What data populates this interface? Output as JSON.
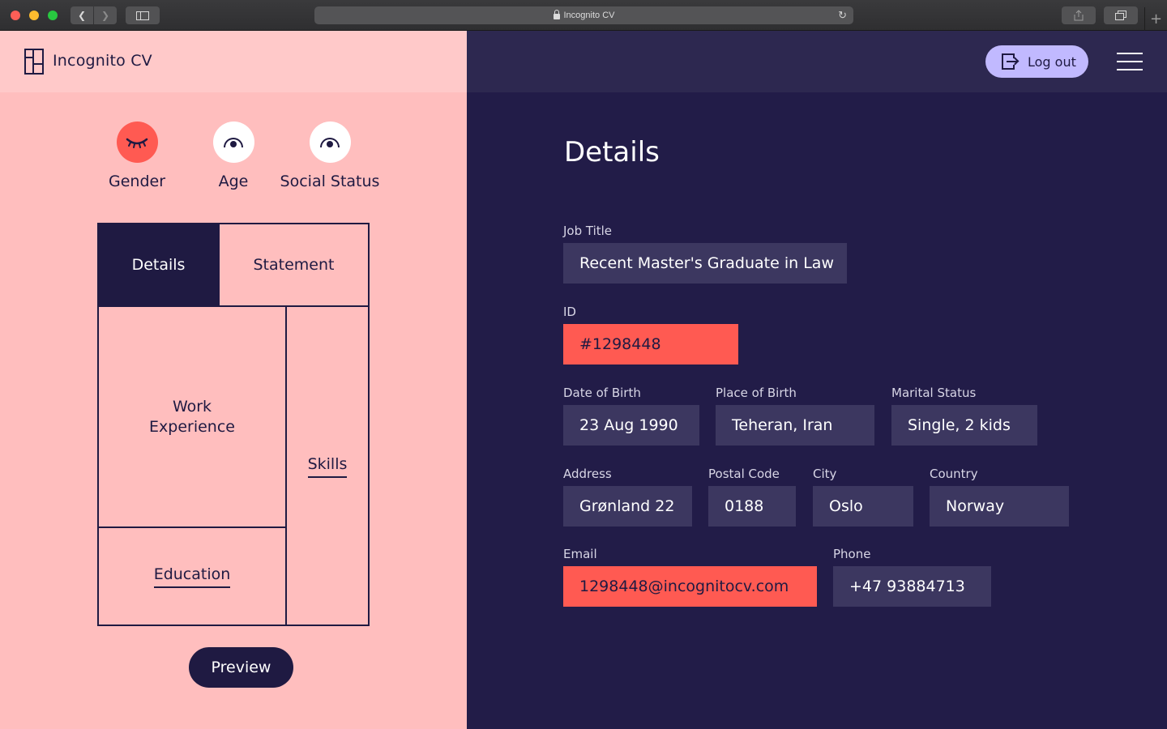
{
  "browser": {
    "url_text": "Incognito CV"
  },
  "app": {
    "brand": "Incognito CV"
  },
  "toggles": [
    {
      "label": "Gender",
      "state": "hidden"
    },
    {
      "label": "Age",
      "state": "visible"
    },
    {
      "label": "Social Status",
      "state": "visible"
    }
  ],
  "sections": {
    "details": "Details",
    "statement": "Statement",
    "work_line1": "Work",
    "work_line2": "Experience",
    "skills": "Skills",
    "education": "Education"
  },
  "preview_label": "Preview",
  "header": {
    "logout_label": "Log out"
  },
  "details": {
    "title": "Details",
    "job_title": {
      "label": "Job Title",
      "value": "Recent Master's Graduate in Law"
    },
    "id": {
      "label": "ID",
      "value": "#1298448"
    },
    "dob": {
      "label": "Date of Birth",
      "value": "23 Aug 1990"
    },
    "pob": {
      "label": "Place of Birth",
      "value": "Teheran, Iran"
    },
    "marital": {
      "label": "Marital Status",
      "value": "Single, 2 kids"
    },
    "address": {
      "label": "Address",
      "value": "Grønland 22"
    },
    "postal": {
      "label": "Postal Code",
      "value": "0188"
    },
    "city": {
      "label": "City",
      "value": "Oslo"
    },
    "country": {
      "label": "Country",
      "value": "Norway"
    },
    "email": {
      "label": "Email",
      "value": "1298448@incognitocv.com"
    },
    "phone": {
      "label": "Phone",
      "value": "+47 93884713"
    }
  },
  "colors": {
    "navy": "#1f1a42",
    "pink": "#ffbebe",
    "coral": "#ff5a52",
    "lavender": "#c1b9ff",
    "field": "#3c3760"
  }
}
